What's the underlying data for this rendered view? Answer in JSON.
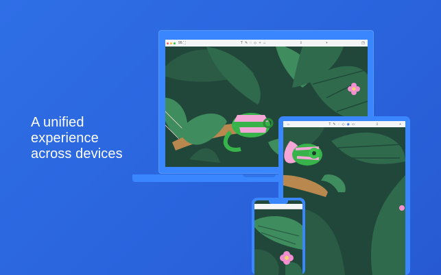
{
  "headline": {
    "line1": "A unified",
    "line2": "experience",
    "line3": "across devices"
  },
  "colors": {
    "background": "#2b66de",
    "device_frame": "#3a86ff",
    "canvas_bg": "#21473a",
    "leaf_dark": "#2b5b45",
    "leaf_green": "#3f8d5e",
    "chameleon_green": "#38b24a",
    "chameleon_pink": "#f4a6d7",
    "branch": "#b9884f",
    "flower": "#f28fcf"
  },
  "laptop_toolbar": {
    "left_label": "99 ⛶",
    "tools": [
      "T",
      "✎",
      "◌",
      "◇",
      "✧",
      "⌂"
    ],
    "right_icons": [
      "⇩",
      "+",
      "◳"
    ]
  },
  "tablet_toolbar": {
    "left_label": "⌂",
    "tools": [
      "T",
      "✎",
      "◌",
      "◇",
      "◉",
      "▭"
    ],
    "right_icons": [
      "⇩",
      "+"
    ]
  }
}
